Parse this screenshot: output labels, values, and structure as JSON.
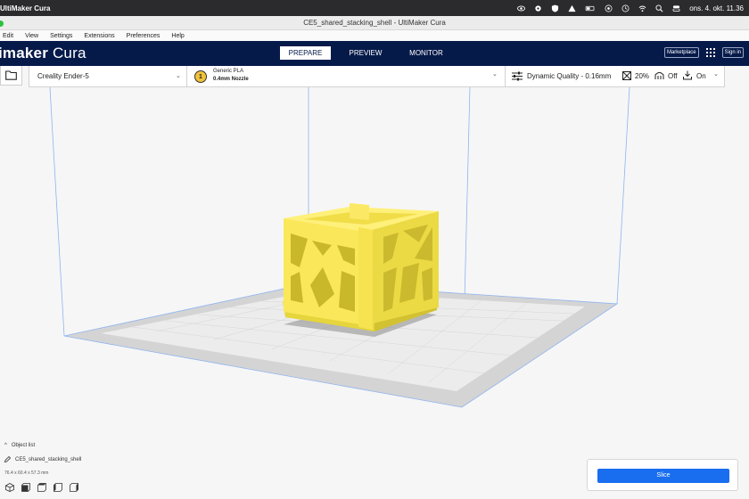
{
  "os": {
    "app_name": "UltiMaker Cura",
    "clock": "ons. 4. okt.  11.36"
  },
  "window": {
    "title": "CE5_shared_stacking_shell - UltiMaker Cura"
  },
  "menu": [
    "Edit",
    "View",
    "Settings",
    "Extensions",
    "Preferences",
    "Help"
  ],
  "header": {
    "logo_light": "imaker",
    "logo_rest": " Cura",
    "tabs": [
      "PREPARE",
      "PREVIEW",
      "MONITOR"
    ],
    "active_tab": "PREPARE",
    "marketplace": "Marketplace",
    "sign_in": "Sign in"
  },
  "toolbar": {
    "printer": "Creality Ender-5",
    "material_number": "1",
    "material": "Generic PLA",
    "nozzle": "0.4mm Nozzle",
    "profile": "Dynamic Quality - 0.16mm",
    "infill": "20%",
    "support": "Off",
    "adhesion": "On"
  },
  "objects": {
    "title": "Object list",
    "items": [
      "CE5_shared_stacking_shell"
    ],
    "dimensions": "76.4 x 60.4 x 57.3 mm"
  },
  "slice": {
    "label": "Slice"
  },
  "colors": {
    "header_bg": "#061a4a",
    "accent": "#196ef0",
    "model": "#f5e34a",
    "bed": "#d8d8d8"
  }
}
